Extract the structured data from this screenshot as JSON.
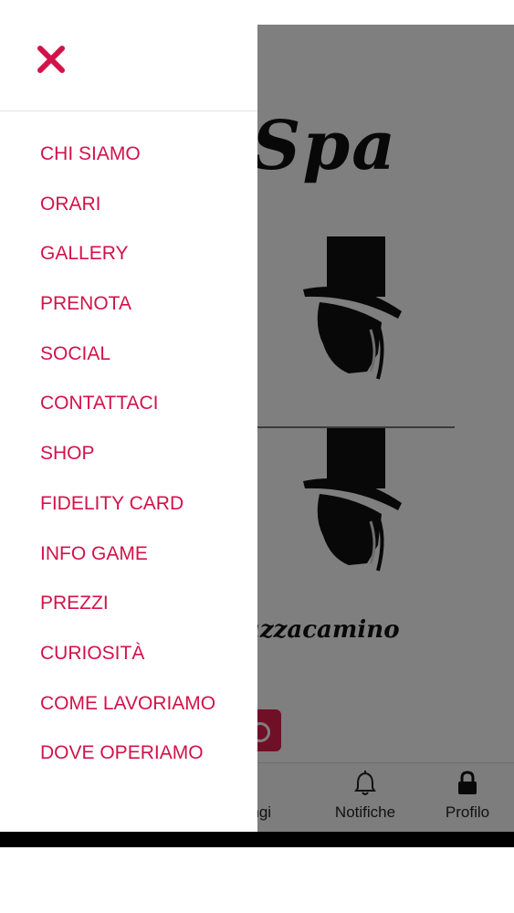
{
  "colors": {
    "accent": "#d1134a",
    "close_icon": "#d1134a",
    "overlay": "rgba(0,0,0,0.5)"
  },
  "background": {
    "title": "Spa",
    "brand_text": "azzacamino"
  },
  "drawer": {
    "close_icon": "close-icon",
    "items": [
      {
        "label": "CHI SIAMO"
      },
      {
        "label": "ORARI"
      },
      {
        "label": "GALLERY"
      },
      {
        "label": "PRENOTA"
      },
      {
        "label": "SOCIAL"
      },
      {
        "label": "CONTATTACI"
      },
      {
        "label": "SHOP"
      },
      {
        "label": "FIDELITY CARD"
      },
      {
        "label": "INFO GAME"
      },
      {
        "label": "PREZZI"
      },
      {
        "label": "CURIOSITÀ"
      },
      {
        "label": "COME LAVORIAMO"
      },
      {
        "label": "DOVE OPERIAMO"
      }
    ]
  },
  "bottom_nav": {
    "add_label": "ungi",
    "notifications_label": "Notifiche",
    "profile_label": "Profilo"
  }
}
